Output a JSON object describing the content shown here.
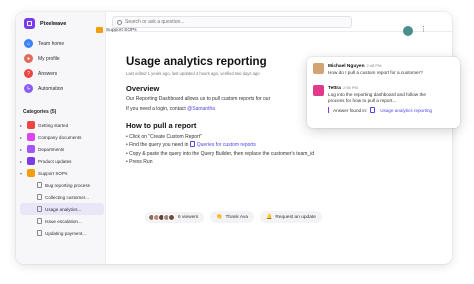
{
  "app": {
    "name": "Pixelwave"
  },
  "search": {
    "placeholder": "Search or ask a question..."
  },
  "nav": [
    {
      "label": "Team home",
      "color": "#3b82f6",
      "icon": "home-icon"
    },
    {
      "label": "My profile",
      "color": "#e26a5b",
      "icon": "user-icon"
    },
    {
      "label": "Answers",
      "color": "#ef4444",
      "icon": "question-icon"
    },
    {
      "label": "Automation",
      "color": "#8b5cf6",
      "icon": "bolt-icon"
    }
  ],
  "categories": {
    "title": "Categories (5)",
    "items": [
      {
        "label": "Getting started",
        "color": "#ef4444"
      },
      {
        "label": "Company documents",
        "color": "#d946ef"
      },
      {
        "label": "Departments",
        "color": "#a855f7"
      },
      {
        "label": "Product updates",
        "color": "#7c3aed"
      },
      {
        "label": "Support SOPs",
        "color": "#f59e0b"
      }
    ],
    "sub_items": [
      "Bug reporting process",
      "Collecting customer...",
      "Usage analytics...",
      "Issue escalation...",
      "Updating payment..."
    ]
  },
  "breadcrumb": "Support SOPs",
  "doc": {
    "title": "Usage analytics reporting",
    "meta": "Last edited 1 years ago, last updated 4 hours ago, verified two days ago",
    "overview_heading": "Overview",
    "overview_p1": "Our Reporting Dashboard allows us to pull custom reports for our",
    "overview_p2a": "If you need a login, contact ",
    "overview_p2b": "@Samantha",
    "howto_heading": "How to pull a report",
    "steps": [
      "Click on \"Create Custom Report\"",
      "Find the query you need in",
      "Copy & paste the query into the Query Builder, then replace the customer's team_id",
      "Press Run"
    ],
    "steps_link": "Queries for custom reports"
  },
  "footer": {
    "viewers": "6 viewers",
    "thank": "Thank Ava",
    "request": "Request an update",
    "avatar_colors": [
      "#8d6e63",
      "#c0887a",
      "#5d4037",
      "#a1887f",
      "#6d4c41"
    ]
  },
  "chat": {
    "q_name": "Michael Nguyen",
    "q_time": "2:48 PM",
    "q_text": "How do I pull a custom report for a customer?",
    "a_name": "Tettra",
    "a_time": "2:56 PM",
    "a_text1": "Log into the reporting dashboard and follow the",
    "a_text2": "process for how to pull a report...",
    "answer_label": "Answer found in:",
    "answer_link": "Usage analytics reporting"
  }
}
